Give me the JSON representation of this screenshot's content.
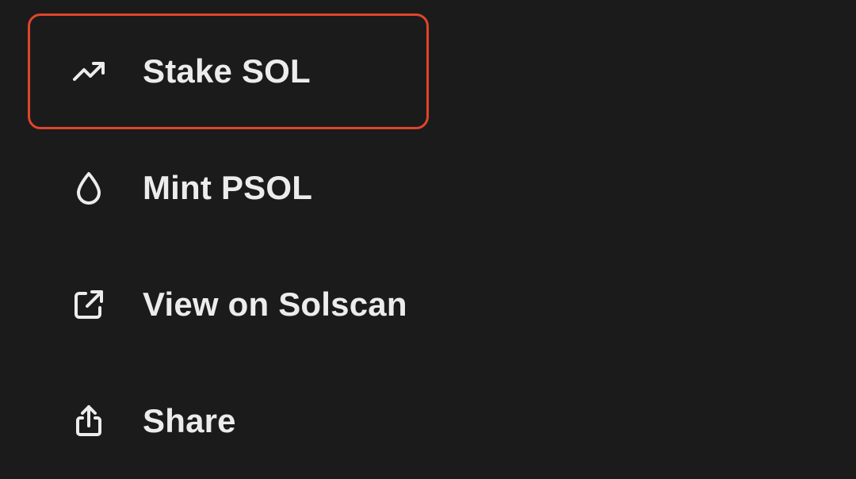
{
  "menu": {
    "items": [
      {
        "label": "Stake SOL",
        "icon": "trending-up-icon",
        "highlighted": true
      },
      {
        "label": "Mint PSOL",
        "icon": "droplet-icon",
        "highlighted": false
      },
      {
        "label": "View on Solscan",
        "icon": "external-link-icon",
        "highlighted": false
      },
      {
        "label": "Share",
        "icon": "share-icon",
        "highlighted": false
      }
    ]
  },
  "colors": {
    "background": "#1b1b1b",
    "text": "#ececec",
    "highlight_border": "#e0442b"
  }
}
